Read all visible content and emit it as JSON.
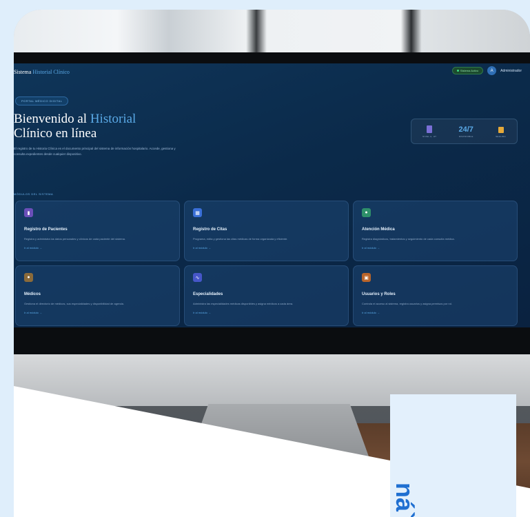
{
  "app": {
    "brand_prefix": "Sistema",
    "brand_accent": "Historial Clínico",
    "status_label": "Sistema Activo",
    "user_name": "Administrador",
    "user_initial": "A"
  },
  "hero": {
    "tag": "PORTAL MÉDICO DIGITAL",
    "title_line1": "Bienvenido al",
    "title_accent": "Historial",
    "title_line2": "Clínico en línea",
    "description": "El registro de tu Historia Clínica es el documento principal del sistema de información hospitalario. Accede, gestiona y consulta expedientes desde cualquier dispositivo."
  },
  "stats": [
    {
      "value": "",
      "label": "NIVEL A, HT",
      "icon": "document-icon"
    },
    {
      "value": "24/7",
      "label": "DISPONIBLE",
      "icon": ""
    },
    {
      "value": "",
      "label": "SEGURO",
      "icon": "lock-icon"
    }
  ],
  "modules": {
    "section_label": "MÓDULOS DEL SISTEMA",
    "items": [
      {
        "title": "Registro de Pacientes",
        "desc": "Registra y administra los datos personales y clínicos de cada paciente del sistema.",
        "link": "Ir al módulo →",
        "icon": "user-icon",
        "color": "#6b4fb8"
      },
      {
        "title": "Registro de Citas",
        "desc": "Programa, edita y gestiona las citas médicas de forma organizada y eficiente.",
        "link": "Ir al módulo →",
        "icon": "calendar-icon",
        "color": "#3a6fd8"
      },
      {
        "title": "Atención Médica",
        "desc": "Registra diagnósticos, tratamientos y seguimiento de cada consulta médica.",
        "link": "Ir al módulo →",
        "icon": "pill-icon",
        "color": "#2e8f6a"
      },
      {
        "title": "Médicos",
        "desc": "Gestiona el directorio de médicos, sus especialidades y disponibilidad de agenda.",
        "link": "Ir al módulo →",
        "icon": "doctor-icon",
        "color": "#8a6a3a"
      },
      {
        "title": "Especialidades",
        "desc": "Administra las especialidades médicas disponibles y asigna médicos a cada área.",
        "link": "Ir al módulo →",
        "icon": "stethoscope-icon",
        "color": "#4656c8"
      },
      {
        "title": "Usuarios y Roles",
        "desc": "Controla el acceso al sistema, registra usuarios y asigna permisos por rol.",
        "link": "Ir al módulo →",
        "icon": "users-icon",
        "color": "#b8642a"
      }
    ]
  },
  "badge": {
    "text": "ná`"
  }
}
